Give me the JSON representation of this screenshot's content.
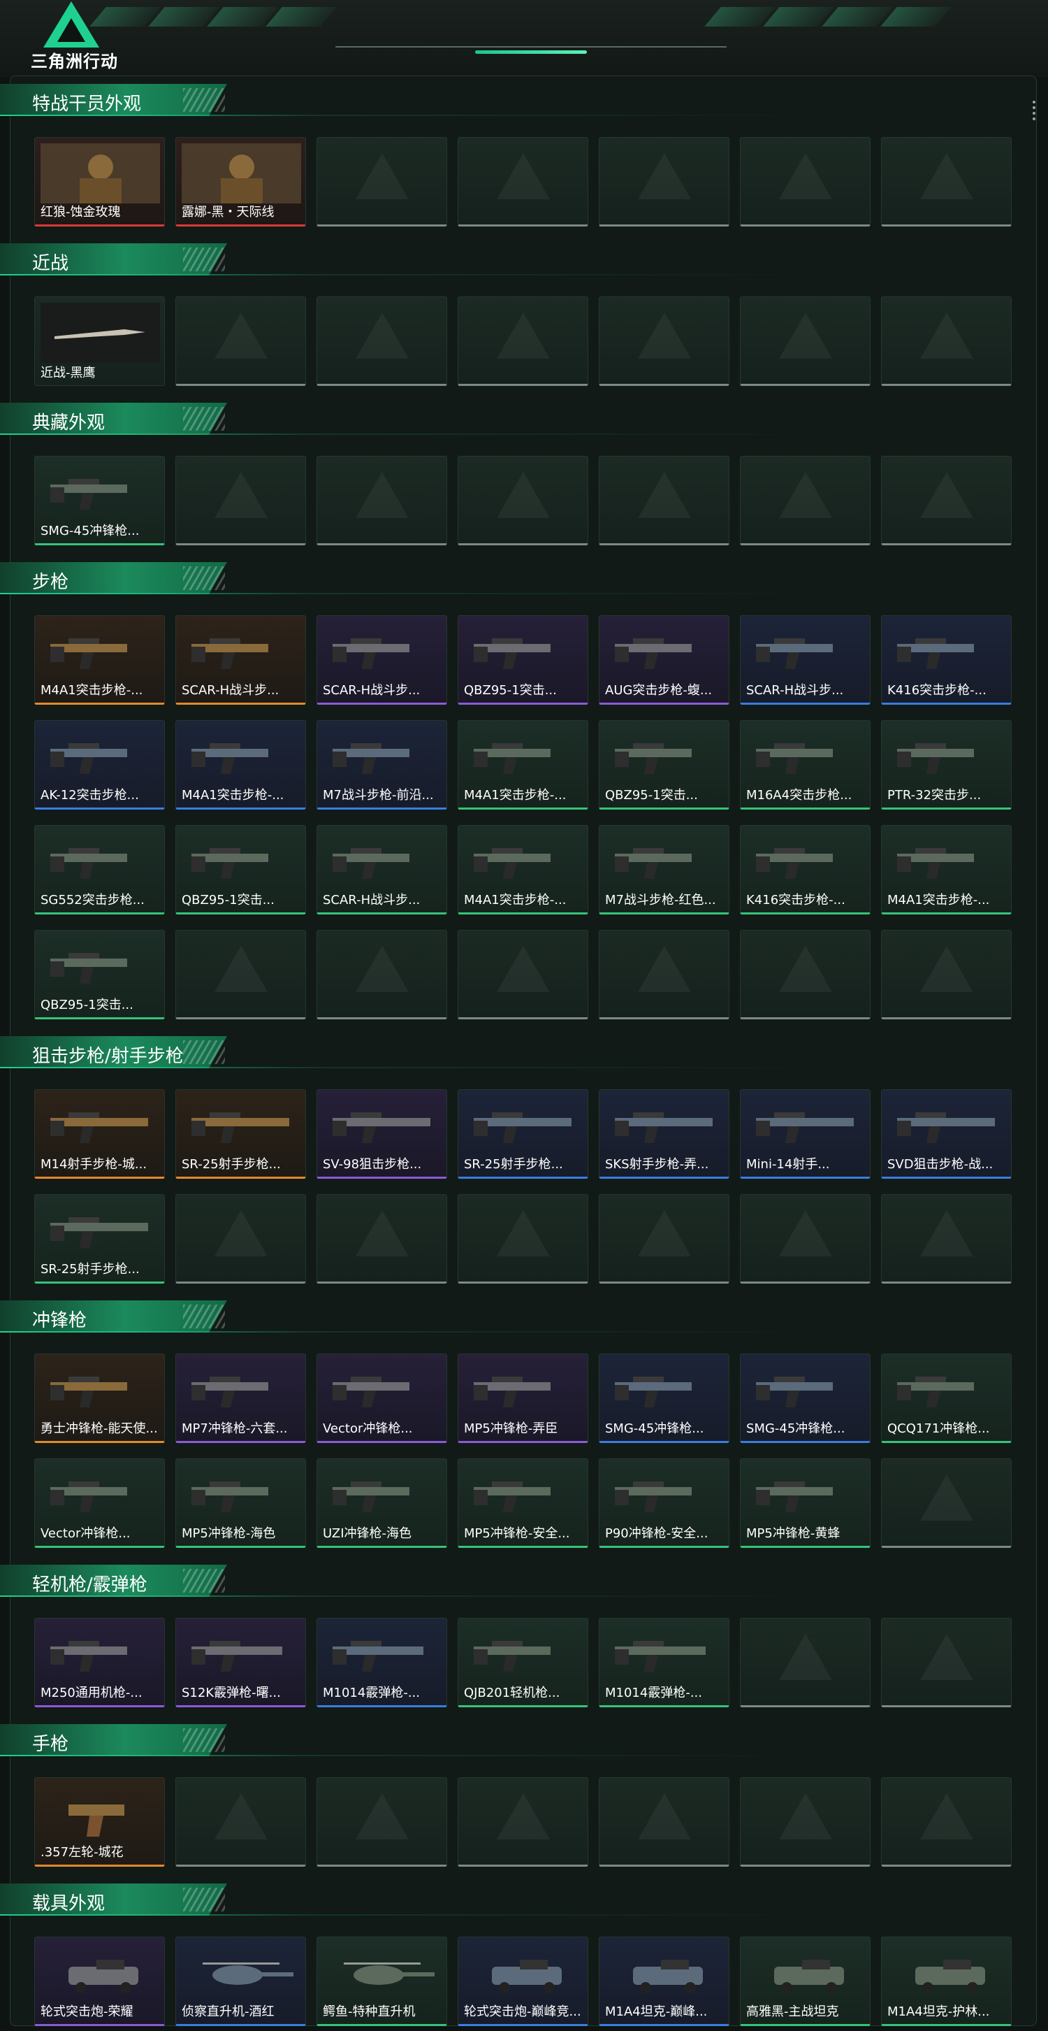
{
  "app": {
    "logo_text": "三角洲行动"
  },
  "colors": {
    "accent": "#1fd191",
    "red": "#d83b3b",
    "orange": "#e38a2c",
    "purple": "#8b5bd6",
    "blue": "#3a7de0",
    "green": "#35c47a"
  },
  "sections": [
    {
      "title": "特战干员外观",
      "items": [
        {
          "label": "红狼-蚀金玫瑰",
          "rarity": "red",
          "icon": "operator-portrait"
        },
        {
          "label": "露娜-黑・天际线",
          "rarity": "red",
          "icon": "operator-portrait"
        },
        null,
        null,
        null,
        null,
        null
      ]
    },
    {
      "title": "近战",
      "items": [
        {
          "label": "近战-黑鹰",
          "rarity": "gray",
          "icon": "knife"
        },
        null,
        null,
        null,
        null,
        null,
        null
      ]
    },
    {
      "title": "典藏外观",
      "items": [
        {
          "label": "SMG-45冲锋枪...",
          "rarity": "green",
          "icon": "smg"
        },
        null,
        null,
        null,
        null,
        null,
        null
      ]
    },
    {
      "title": "步枪",
      "items": [
        {
          "label": "M4A1突击步枪-...",
          "rarity": "orange",
          "icon": "rifle"
        },
        {
          "label": "SCAR-H战斗步...",
          "rarity": "orange",
          "icon": "rifle"
        },
        {
          "label": "SCAR-H战斗步...",
          "rarity": "purple",
          "icon": "rifle"
        },
        {
          "label": "QBZ95-1突击...",
          "rarity": "purple",
          "icon": "rifle"
        },
        {
          "label": "AUG突击步枪-蝮...",
          "rarity": "purple",
          "icon": "rifle"
        },
        {
          "label": "SCAR-H战斗步...",
          "rarity": "blue",
          "icon": "rifle"
        },
        {
          "label": "K416突击步枪-...",
          "rarity": "blue",
          "icon": "rifle"
        },
        {
          "label": "AK-12突击步枪...",
          "rarity": "blue",
          "icon": "rifle"
        },
        {
          "label": "M4A1突击步枪-...",
          "rarity": "blue",
          "icon": "rifle"
        },
        {
          "label": "M7战斗步枪-前沿...",
          "rarity": "blue",
          "icon": "rifle"
        },
        {
          "label": "M4A1突击步枪-...",
          "rarity": "green",
          "icon": "rifle"
        },
        {
          "label": "QBZ95-1突击...",
          "rarity": "green",
          "icon": "rifle"
        },
        {
          "label": "M16A4突击步枪...",
          "rarity": "green",
          "icon": "rifle"
        },
        {
          "label": "PTR-32突击步...",
          "rarity": "green",
          "icon": "rifle"
        },
        {
          "label": "SG552突击步枪...",
          "rarity": "green",
          "icon": "rifle"
        },
        {
          "label": "QBZ95-1突击...",
          "rarity": "green",
          "icon": "rifle"
        },
        {
          "label": "SCAR-H战斗步...",
          "rarity": "green",
          "icon": "rifle"
        },
        {
          "label": "M4A1突击步枪-...",
          "rarity": "green",
          "icon": "rifle"
        },
        {
          "label": "M7战斗步枪-红色...",
          "rarity": "green",
          "icon": "rifle"
        },
        {
          "label": "K416突击步枪-...",
          "rarity": "green",
          "icon": "rifle"
        },
        {
          "label": "M4A1突击步枪-...",
          "rarity": "green",
          "icon": "rifle"
        },
        {
          "label": "QBZ95-1突击...",
          "rarity": "green",
          "icon": "rifle"
        },
        null,
        null,
        null,
        null,
        null,
        null
      ]
    },
    {
      "title": "狙击步枪/射手步枪",
      "items": [
        {
          "label": "M14射手步枪-城...",
          "rarity": "orange",
          "icon": "sniper"
        },
        {
          "label": "SR-25射手步枪...",
          "rarity": "orange",
          "icon": "sniper"
        },
        {
          "label": "SV-98狙击步枪...",
          "rarity": "purple",
          "icon": "sniper"
        },
        {
          "label": "SR-25射手步枪...",
          "rarity": "blue",
          "icon": "sniper"
        },
        {
          "label": "SKS射手步枪-弄...",
          "rarity": "blue",
          "icon": "sniper"
        },
        {
          "label": "Mini-14射手...",
          "rarity": "blue",
          "icon": "sniper"
        },
        {
          "label": "SVD狙击步枪-战...",
          "rarity": "blue",
          "icon": "sniper"
        },
        {
          "label": "SR-25射手步枪...",
          "rarity": "green",
          "icon": "sniper"
        },
        null,
        null,
        null,
        null,
        null,
        null
      ]
    },
    {
      "title": "冲锋枪",
      "items": [
        {
          "label": "勇士冲锋枪-能天使...",
          "rarity": "orange",
          "icon": "smg"
        },
        {
          "label": "MP7冲锋枪-六套...",
          "rarity": "purple",
          "icon": "smg"
        },
        {
          "label": "Vector冲锋枪...",
          "rarity": "purple",
          "icon": "smg"
        },
        {
          "label": "MP5冲锋枪-弄臣",
          "rarity": "purple",
          "icon": "smg"
        },
        {
          "label": "SMG-45冲锋枪...",
          "rarity": "blue",
          "icon": "smg"
        },
        {
          "label": "SMG-45冲锋枪...",
          "rarity": "blue",
          "icon": "smg"
        },
        {
          "label": "QCQ171冲锋枪...",
          "rarity": "green",
          "icon": "smg"
        },
        {
          "label": "Vector冲锋枪...",
          "rarity": "green",
          "icon": "smg"
        },
        {
          "label": "MP5冲锋枪-海色",
          "rarity": "green",
          "icon": "smg"
        },
        {
          "label": "UZI冲锋枪-海色",
          "rarity": "green",
          "icon": "smg"
        },
        {
          "label": "MP5冲锋枪-安全...",
          "rarity": "green",
          "icon": "smg"
        },
        {
          "label": "P90冲锋枪-安全...",
          "rarity": "green",
          "icon": "smg"
        },
        {
          "label": "MP5冲锋枪-黄蜂",
          "rarity": "green",
          "icon": "smg"
        },
        null
      ]
    },
    {
      "title": "轻机枪/霰弹枪",
      "items": [
        {
          "label": "M250通用机枪-...",
          "rarity": "purple",
          "icon": "lmg"
        },
        {
          "label": "S12K霰弹枪-曙...",
          "rarity": "purple",
          "icon": "shotgun"
        },
        {
          "label": "M1014霰弹枪-...",
          "rarity": "blue",
          "icon": "shotgun"
        },
        {
          "label": "QJB201轻机枪...",
          "rarity": "green",
          "icon": "lmg"
        },
        {
          "label": "M1014霰弹枪-...",
          "rarity": "green",
          "icon": "shotgun"
        },
        null,
        null
      ]
    },
    {
      "title": "手枪",
      "items": [
        {
          "label": ".357左轮-城花",
          "rarity": "orange",
          "icon": "pistol"
        },
        null,
        null,
        null,
        null,
        null,
        null
      ]
    },
    {
      "title": "载具外观",
      "items": [
        {
          "label": "轮式突击炮-荣耀",
          "rarity": "purple",
          "icon": "vehicle"
        },
        {
          "label": "侦察直升机-酒红",
          "rarity": "blue",
          "icon": "helicopter"
        },
        {
          "label": "鳄鱼-特种直升机",
          "rarity": "green",
          "icon": "helicopter"
        },
        {
          "label": "轮式突击炮-巅峰竞...",
          "rarity": "blue",
          "icon": "vehicle"
        },
        {
          "label": "M1A4坦克-巅峰...",
          "rarity": "blue",
          "icon": "tank"
        },
        {
          "label": "高雅黑-主战坦克",
          "rarity": "green",
          "icon": "tank"
        },
        {
          "label": "M1A4坦克-护林...",
          "rarity": "green",
          "icon": "tank"
        }
      ]
    }
  ]
}
